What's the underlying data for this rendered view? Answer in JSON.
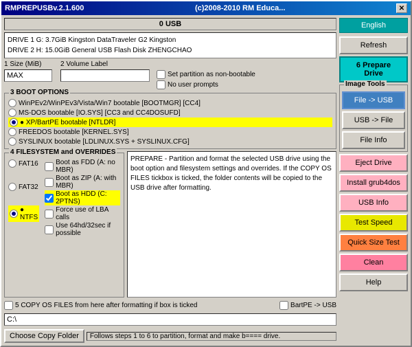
{
  "window": {
    "title": "RMPREPUSBv.2.1.600",
    "title_right": "(c)2008-2010 RM Educa...",
    "close_btn": "✕"
  },
  "header": {
    "usb_label": "0 USB"
  },
  "drives": {
    "drive1": "DRIVE 1    G:     3.7GiB    Kingston DataTraveler G2       Kingston",
    "drive2": "DRIVE 2    H:    15.0GiB    General USB Flash Disk         ZHENGCHAO"
  },
  "size_volume": {
    "label1": "1 Size (MiB)",
    "label2": "2 Volume Label",
    "size_value": "MAX",
    "volume_value": "",
    "set_partition": "Set partition as non-bootable",
    "no_user_prompts": "No user prompts"
  },
  "boot_options": {
    "section_title": "3 BOOT OPTIONS",
    "options": [
      {
        "label": "WinPEv2/WinPEv3/Vista/Win7 bootable [BOOTMGR] [CC4]",
        "selected": false
      },
      {
        "label": "MS-DOS bootable [IO.SYS]  [CC3 and CC4DOSUFD]",
        "selected": false
      },
      {
        "label": "XP/BartPE bootable [NTLDR]",
        "selected": true
      },
      {
        "label": "FREEDOS bootable [KERNEL.SYS]",
        "selected": false
      },
      {
        "label": "SYSLINUX bootable [LDLINUX.SYS + SYSLINUX.CFG]",
        "selected": false
      }
    ]
  },
  "image_tools": {
    "title": "Image Tools",
    "btn1": "File -> USB",
    "btn2": "USB -> File",
    "btn3": "File Info"
  },
  "filesystem": {
    "section_title": "4 FILESYSTEM and OVERRIDES",
    "options": [
      {
        "label": "FAT16",
        "selected": false
      },
      {
        "label": "FAT32",
        "selected": false
      },
      {
        "label": "NTFS",
        "selected": true
      }
    ],
    "sub_options": [
      {
        "label": "Boot as FDD (A: no MBR)",
        "checked": false
      },
      {
        "label": "Boot as ZIP (A: with MBR)",
        "checked": false
      },
      {
        "label": "Boot as HDD (C: 2PTNS)",
        "checked": true
      },
      {
        "label": "Force use of LBA calls",
        "checked": false
      },
      {
        "label": "Use 64hd/32sec if possible",
        "checked": false
      }
    ]
  },
  "prepare_text": "PREPARE - Partition and format the selected USB drive using the boot option and filesystem settings and overrides. If the COPY OS FILES tickbox is ticked, the folder contents will be copied to the USB drive after formatting.",
  "copy_section": {
    "label": "5 COPY OS FILES from here after formatting if box is ticked",
    "bartpe_label": "BartPE -> USB",
    "folder_path": "C:\\"
  },
  "buttons": {
    "language": "English",
    "refresh": "Refresh",
    "prepare_drive": "6 Prepare Drive",
    "eject_drive": "Eject Drive",
    "install_grub4dos": "Install grub4dos",
    "usb_info": "USB Info",
    "test_speed": "Test Speed",
    "quick_size_test": "Quick Size Test",
    "clean": "Clean",
    "help": "Help"
  },
  "footer": {
    "choose_copy_folder": "Choose Copy Folder",
    "step_text": "Follows steps 1 to 6 to partition, format and make b==== drive."
  }
}
